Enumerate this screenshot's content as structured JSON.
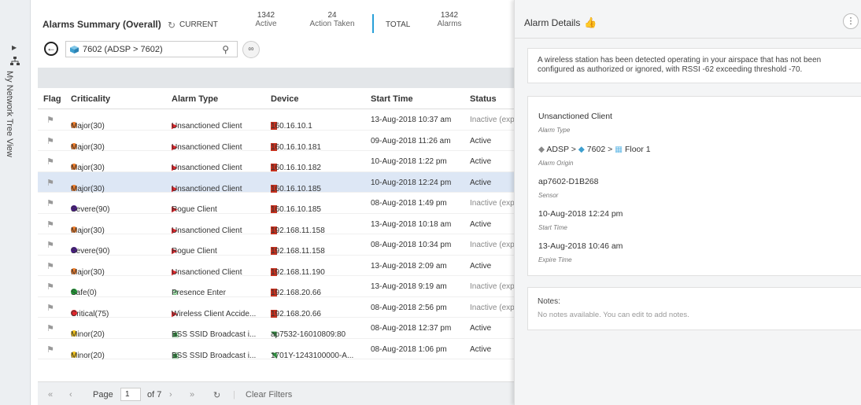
{
  "sidebar": {
    "tree_label": "My Network Tree View"
  },
  "summary": {
    "title": "Alarms Summary (Overall)",
    "current_label": "CURRENT",
    "active_count": "1342",
    "active_label": "Active",
    "action_count": "24",
    "action_label": "Action Taken",
    "total_label": "TOTAL",
    "alarms_count": "1342",
    "alarms_label": "Alarms"
  },
  "toolbar": {
    "location": "7602 (ADSP > 7602)"
  },
  "table": {
    "columns": [
      "Flag",
      "Criticality",
      "Alarm Type",
      "Device",
      "Start Time",
      "Status"
    ],
    "rows": [
      {
        "criticality": "Major(30)",
        "type": "Unsanctioned Client",
        "device": "160.16.10.1",
        "start": "13-Aug-2018 10:37 am",
        "status": "Inactive (expir"
      },
      {
        "criticality": "Major(30)",
        "type": "Unsanctioned Client",
        "device": "160.16.10.181",
        "start": "09-Aug-2018 11:26 am",
        "status": "Active"
      },
      {
        "criticality": "Major(30)",
        "type": "Unsanctioned Client",
        "device": "160.16.10.182",
        "start": "10-Aug-2018 1:22 pm",
        "status": "Active"
      },
      {
        "criticality": "Major(30)",
        "type": "Unsanctioned Client",
        "device": "160.16.10.185",
        "start": "10-Aug-2018 12:24 pm",
        "status": "Active"
      },
      {
        "criticality": "Severe(90)",
        "type": "Rogue Client",
        "device": "160.16.10.185",
        "start": "08-Aug-2018 1:49 pm",
        "status": "Inactive (expir"
      },
      {
        "criticality": "Major(30)",
        "type": "Unsanctioned Client",
        "device": "192.168.11.158",
        "start": "13-Aug-2018 10:18 am",
        "status": "Active"
      },
      {
        "criticality": "Severe(90)",
        "type": "Rogue Client",
        "device": "192.168.11.158",
        "start": "08-Aug-2018 10:34 pm",
        "status": "Inactive (expir"
      },
      {
        "criticality": "Major(30)",
        "type": "Unsanctioned Client",
        "device": "192.168.11.190",
        "start": "13-Aug-2018 2:09 am",
        "status": "Active"
      },
      {
        "criticality": "Safe(0)",
        "type": "Presence Enter",
        "device": "192.168.20.66",
        "start": "13-Aug-2018 9:19 am",
        "status": "Inactive (expir"
      },
      {
        "criticality": "Critical(75)",
        "type": "Wireless Client Accide...",
        "device": "192.168.20.66",
        "start": "08-Aug-2018 2:56 pm",
        "status": "Inactive (expir"
      },
      {
        "criticality": "Minor(20)",
        "type": "BSS SSID Broadcast i...",
        "device": "ap7532-16010809:80",
        "start": "08-Aug-2018 12:37 pm",
        "status": "Active"
      },
      {
        "criticality": "Minor(20)",
        "type": "BSS SSID Broadcast i...",
        "device": "1701Y-1243100000-A...",
        "start": "08-Aug-2018 1:06 pm",
        "status": "Active"
      }
    ]
  },
  "pager": {
    "page_label": "Page",
    "page_value": "1",
    "of_label": "of 7",
    "clear_label": "Clear Filters"
  },
  "details": {
    "title": "Alarm Details",
    "description": "A wireless station has been detected operating in your airspace that has not been configured as authorized or ignored, with RSSI -62 exceeding threshold -70.",
    "alarm_type": "Unsanctioned Client",
    "alarm_type_label": "Alarm Type",
    "origin_1": "ADSP",
    "origin_2": "7602",
    "origin_3": "Floor 1",
    "origin_label": "Alarm Origin",
    "sensor": "ap7602-D1B268",
    "sensor_label": "Sensor",
    "start_time": "10-Aug-2018 12:24 pm",
    "start_time_label": "Start Time",
    "expire_time": "13-Aug-2018 10:46 am",
    "expire_time_label": "Expire Time",
    "notes_label": "Notes:",
    "notes_text": "No notes available. You can edit to add notes."
  },
  "colors": {
    "major": "#ef7d2a",
    "severe": "#4b1a8c",
    "safe": "#1f9e35",
    "critical": "#e0252a",
    "minor": "#f1c21b",
    "accent": "#28a0d8",
    "selected_row": "#dde7f5"
  }
}
